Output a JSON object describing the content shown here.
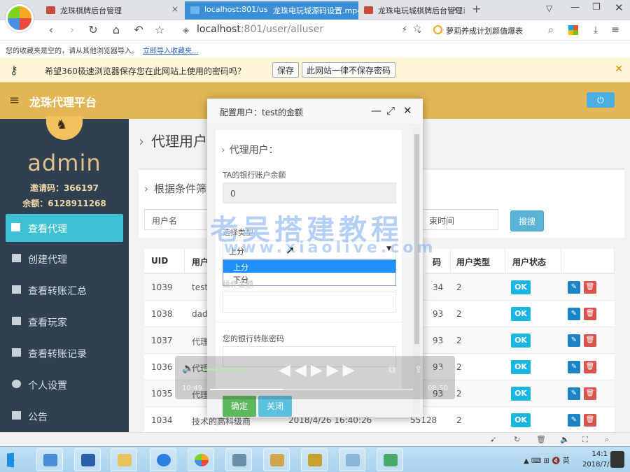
{
  "browser": {
    "tabs": [
      {
        "title": "龙珠棋牌后台管理"
      },
      {
        "title": "localhost:801/user/alluser"
      },
      {
        "title": "龙珠电玩城源码设置.mp4"
      },
      {
        "title": "龙珠电玩城棋牌后台管理系统"
      }
    ],
    "new_tab": "+",
    "address": {
      "host": "localhost",
      "rest": ":801/user/alluser"
    },
    "search_text": "萝莉养成计划颜值爆表",
    "bookmark_msg": "您的收藏夹是空的，请从其他浏览器导入。",
    "bookmark_link": "立即导入收藏夹...",
    "pw_bar": {
      "message": "希望360极速浏览器保存您在此网站上使用的密码吗？",
      "save": "保存",
      "never": "此网站一律不保存密码"
    }
  },
  "app": {
    "brand": "龙珠代理平台",
    "user": {
      "name": "admin",
      "invite": "邀请码：366197",
      "balance": "余额：6128911268"
    },
    "sidebar": [
      {
        "label": "查看代理",
        "active": true
      },
      {
        "label": "创建代理"
      },
      {
        "label": "查看转账汇总"
      },
      {
        "label": "查看玩家"
      },
      {
        "label": "查看转账记录"
      },
      {
        "label": "个人设置"
      },
      {
        "label": "公告"
      }
    ],
    "page_title": "代理用户",
    "filter": {
      "title": "根据条件筛",
      "username_placeholder": "用户名",
      "end_time_placeholder": "束时间",
      "search_btn": "搜搜"
    },
    "table": {
      "headers": [
        "UID",
        "用户",
        "码",
        "用户类型",
        "用户状态"
      ],
      "rows": [
        {
          "uid": "1039",
          "user": "test",
          "code": "34",
          "type": "2",
          "status": "OK"
        },
        {
          "uid": "1038",
          "user": "dad",
          "code": "93",
          "type": "2",
          "status": "OK"
        },
        {
          "uid": "1037",
          "user": "代理",
          "code": "93",
          "type": "2",
          "status": "OK"
        },
        {
          "uid": "1036",
          "user": "代理",
          "code": "93",
          "type": "2",
          "status": "OK"
        },
        {
          "uid": "1035",
          "user": "代理",
          "code": "93",
          "type": "2",
          "status": "OK"
        },
        {
          "uid": "1034",
          "user": "技术的高科级商",
          "time": "2018/4/26 16:40:26",
          "code": "55128",
          "type": "2",
          "status": "OK"
        }
      ]
    }
  },
  "modal": {
    "title": "配置用户：test的金额",
    "section": "代理用户：",
    "balance_label": "TA的银行账户余额",
    "balance_value": "0",
    "type_label": "选择类型",
    "type_selected": "上分",
    "options": [
      "上分",
      "下分"
    ],
    "amount_label": "操作金额",
    "pwd_label": "您的银行转账密码",
    "confirm": "确定",
    "close": "关闭"
  },
  "watermark": {
    "line1": "老吴搭建教程",
    "line2": "www.xiaolive.com"
  },
  "video": {
    "time_left": "10:49",
    "time_right": "08:50"
  },
  "taskbar": {
    "ime": "英",
    "time": "14:1",
    "date": "2018/7/14"
  }
}
